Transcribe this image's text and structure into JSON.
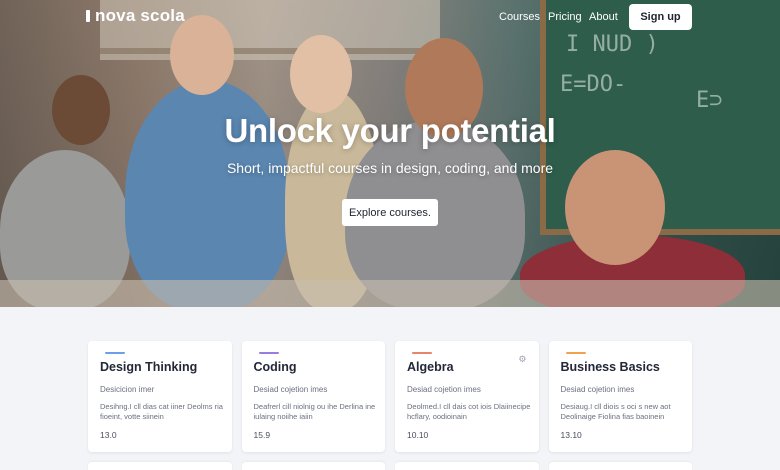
{
  "brand": {
    "name": "nova scola"
  },
  "nav": {
    "links": [
      "Courses",
      "Pricing",
      "About"
    ],
    "signup_label": "Sign up"
  },
  "hero": {
    "title": "Unlock your potential",
    "subtitle": "Short, impactful courses in design, coding, and more",
    "cta_label": "Explore courses.",
    "board_lines": [
      "I NUD )",
      "E=DO-",
      "E⊃"
    ]
  },
  "courses": [
    {
      "title": "Design Thinking",
      "subtitle": "Desicicion imer",
      "description": "Desihng.I cll dias cat iiner Deolms ria fioeint, votte siinein",
      "number": "13.0",
      "accent": "#6aa0e8",
      "icon": ""
    },
    {
      "title": "Coding",
      "subtitle": "Desiad cojetion imes",
      "description": "Deafrerl cill niolnig ou ihe Derlina ine iulaing noiihe iaiin",
      "number": "15.9",
      "accent": "#9a7be0",
      "icon": ""
    },
    {
      "title": "Algebra",
      "subtitle": "Desiad cojetion imes",
      "description": "Deolmed.I cll dais cot iois Dlaiinecipe hcflary, oodioinain",
      "number": "10.10",
      "accent": "#e8846a",
      "icon": "gear-icon"
    },
    {
      "title": "Business Basics",
      "subtitle": "Desiad cojetion imes",
      "description": "Desiaug.I cll diois s oci s new aot Deolinaige Fiolina fias baoinein",
      "number": "13.10",
      "accent": "#f0a24e",
      "icon": ""
    }
  ]
}
